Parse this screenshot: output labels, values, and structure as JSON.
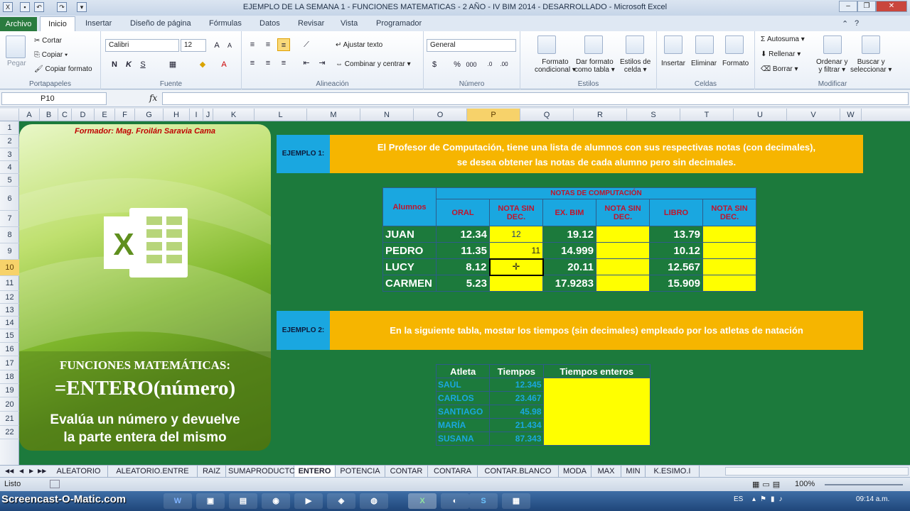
{
  "title": "EJEMPLO DE LA SEMANA 1 - FUNCIONES MATEMATICAS - 2 AÑO - IV BIM 2014 - DESARROLLADO  -  Microsoft Excel",
  "tabs": {
    "file": "Archivo",
    "inicio": "Inicio",
    "insertar": "Insertar",
    "diseno": "Diseño de página",
    "formulas": "Fórmulas",
    "datos": "Datos",
    "revisar": "Revisar",
    "vista": "Vista",
    "programador": "Programador"
  },
  "ribbon": {
    "pegar": "Pegar",
    "cortar": "Cortar",
    "copiar": "Copiar ▾",
    "copiar_formato": "Copiar formato",
    "portapapeles": "Portapapeles",
    "font_name": "Calibri",
    "font_size": "12",
    "fuente": "Fuente",
    "ajustar": "Ajustar texto",
    "combinar": "Combinar y centrar ▾",
    "alineacion": "Alineación",
    "number_format": "General",
    "numero": "Número",
    "formato_cond1": "Formato",
    "formato_cond2": "condicional ▾",
    "dar_formato1": "Dar formato",
    "dar_formato2": "como tabla ▾",
    "estilos_celda1": "Estilos de",
    "estilos_celda2": "celda ▾",
    "estilos": "Estilos",
    "insertar": "Insertar",
    "eliminar": "Eliminar",
    "formato": "Formato",
    "celdas": "Celdas",
    "autosuma": "Autosuma ▾",
    "rellenar": "Rellenar ▾",
    "borrar": "Borrar ▾",
    "ordenar1": "Ordenar y",
    "ordenar2": "y filtrar ▾",
    "buscar1": "Buscar y",
    "buscar2": "seleccionar ▾",
    "modificar": "Modificar"
  },
  "namebox": "P10",
  "fx": "fx",
  "columns": [
    "A",
    "B",
    "C",
    "D",
    "E",
    "F",
    "G",
    "H",
    "I",
    "J",
    "K",
    "L",
    "M",
    "N",
    "O",
    "P",
    "Q",
    "R",
    "S",
    "T",
    "U",
    "V",
    "W"
  ],
  "rows": [
    "1",
    "2",
    "3",
    "4",
    "5",
    "6",
    "7",
    "8",
    "9",
    "10",
    "11",
    "12",
    "13",
    "14",
    "15",
    "16",
    "17",
    "18",
    "19",
    "20",
    "21",
    "22"
  ],
  "banner": {
    "formador": "Formador: Mag. Froilán Saravia Cama",
    "title": "FUNCIONES MATEMÁTICAS:",
    "formula": "=ENTERO(número)",
    "desc1": "Evalúa un número y devuelve",
    "desc2": "la parte entera del mismo"
  },
  "ejemplo1": {
    "label": "EJEMPLO 1:",
    "text1": "El Profesor de Computación, tiene una lista de alumnos con sus respectivas notas (con decimales),",
    "text2": "se desea obtener las notas de cada alumno pero sin decimales."
  },
  "table1": {
    "alumnos": "Alumnos",
    "group": "NOTAS DE COMPUTACIÓN",
    "h": [
      "ORAL",
      "NOTA SIN DEC.",
      "EX. BIM",
      "NOTA SIN DEC.",
      "LIBRO",
      "NOTA SIN DEC."
    ],
    "rows": [
      {
        "name": "JUAN",
        "oral": "12.34",
        "sin1": "12",
        "ex": "19.12",
        "libro": "13.79"
      },
      {
        "name": "PEDRO",
        "oral": "11.35",
        "sin1": "11",
        "ex": "14.999",
        "libro": "10.12"
      },
      {
        "name": "LUCY",
        "oral": "8.12",
        "sin1": "",
        "ex": "20.11",
        "libro": "12.567"
      },
      {
        "name": "CARMEN",
        "oral": "5.23",
        "sin1": "",
        "ex": "17.9283",
        "libro": "15.909"
      }
    ]
  },
  "ejemplo2": {
    "label": "EJEMPLO 2:",
    "text": "En la siguiente tabla, mostar los tiempos (sin decimales)  empleado por los atletas de natación"
  },
  "table2": {
    "h": [
      "Atleta",
      "Tiempos",
      "Tiempos enteros"
    ],
    "rows": [
      {
        "a": "SAÚL",
        "t": "12.345"
      },
      {
        "a": "CARLOS",
        "t": "23.467"
      },
      {
        "a": "SANTIAGO",
        "t": "45.98"
      },
      {
        "a": "MARÍA",
        "t": "21.434"
      },
      {
        "a": "SUSANA",
        "t": "87.343"
      }
    ]
  },
  "sheet_tabs": [
    "ALEATORIO",
    "ALEATORIO.ENTRE",
    "RAIZ",
    "SUMAPRODUCTO",
    "ENTERO",
    "POTENCIA",
    "CONTAR",
    "CONTARA",
    "CONTAR.BLANCO",
    "MODA",
    "MAX",
    "MIN",
    "K.ESIMO.I"
  ],
  "status": {
    "ready": "Listo",
    "zoom": "100%"
  },
  "taskbar": {
    "watermark": "Screencast-O-Matic.com",
    "lang": "ES",
    "time": "09:14 a.m."
  }
}
